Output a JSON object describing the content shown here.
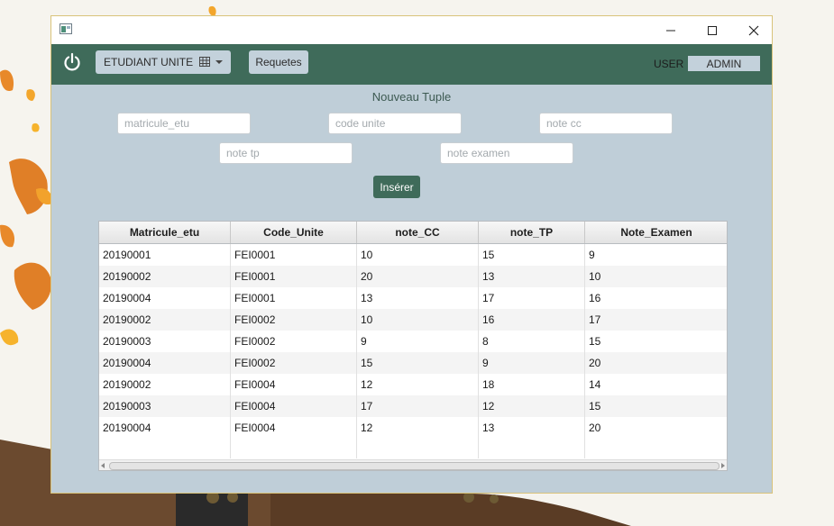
{
  "window": {
    "controls": {
      "minimize_icon": "minimize-icon",
      "maximize_icon": "maximize-icon",
      "close_icon": "close-icon"
    }
  },
  "toolbar": {
    "power_icon": "power-icon",
    "table_selector": {
      "selected": "ETUDIANT UNITE",
      "icon": "table-grid-icon"
    },
    "requetes_label": "Requetes",
    "user_label": "USER",
    "user_value": "ADMIN"
  },
  "form": {
    "title": "Nouveau Tuple",
    "fields": {
      "matricule_etu": {
        "placeholder": "matricule_etu",
        "value": ""
      },
      "code_unite": {
        "placeholder": "code unite",
        "value": ""
      },
      "note_cc": {
        "placeholder": "note cc",
        "value": ""
      },
      "note_tp": {
        "placeholder": "note tp",
        "value": ""
      },
      "note_examen": {
        "placeholder": "note examen",
        "value": ""
      }
    },
    "insert_label": "Insérer"
  },
  "table": {
    "columns": [
      "Matricule_etu",
      "Code_Unite",
      "note_CC",
      "note_TP",
      "Note_Examen"
    ],
    "rows": [
      [
        "20190001",
        "FEI0001",
        "10",
        "15",
        "9"
      ],
      [
        "20190002",
        "FEI0001",
        "20",
        "13",
        "10"
      ],
      [
        "20190004",
        "FEI0001",
        "13",
        "17",
        "16"
      ],
      [
        "20190002",
        "FEI0002",
        "10",
        "16",
        "17"
      ],
      [
        "20190003",
        "FEI0002",
        "9",
        "8",
        "15"
      ],
      [
        "20190004",
        "FEI0002",
        "15",
        "9",
        "20"
      ],
      [
        "20190002",
        "FEI0004",
        "12",
        "18",
        "14"
      ],
      [
        "20190003",
        "FEI0004",
        "17",
        "12",
        "15"
      ],
      [
        "20190004",
        "FEI0004",
        "12",
        "13",
        "20"
      ]
    ]
  }
}
